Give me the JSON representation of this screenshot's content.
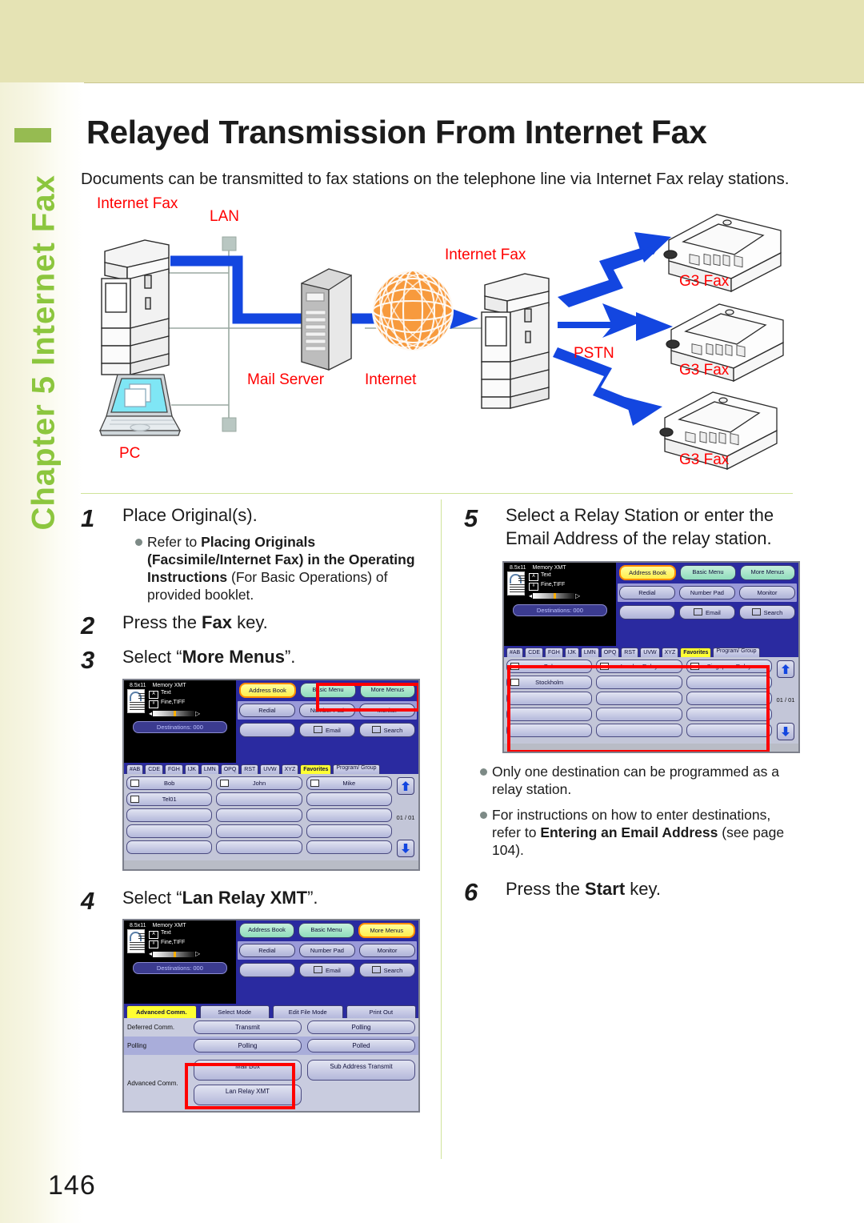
{
  "sidebar": {
    "chapter_label": "Chapter 5  Internet Fax"
  },
  "page": {
    "number": "146",
    "title": "Relayed Transmission From Internet Fax",
    "intro": "Documents can be transmitted to fax stations on the telephone line via Internet Fax relay stations."
  },
  "diagram": {
    "labels": {
      "internet_fax_left": "Internet Fax",
      "lan": "LAN",
      "mail_server": "Mail Server",
      "internet": "Internet",
      "pc": "PC",
      "internet_fax_right": "Internet Fax",
      "pstn": "PSTN",
      "g3fax_1": "G3 Fax",
      "g3fax_2": "G3 Fax",
      "g3fax_3": "G3 Fax"
    }
  },
  "steps": {
    "s1": {
      "num": "1",
      "text": "Place Original(s).",
      "bullet_pre": "Refer to ",
      "bullet_b1": "Placing Originals (Facsimile/Internet Fax) in the Operating Instructions",
      "bullet_post": " (For Basic Operations) of provided booklet."
    },
    "s2": {
      "num": "2",
      "pre": "Press the ",
      "bold": "Fax",
      "post": " key."
    },
    "s3": {
      "num": "3",
      "pre": "Select “",
      "bold": "More Menus",
      "post": "”."
    },
    "s4": {
      "num": "4",
      "pre": "Select “",
      "bold": "Lan Relay XMT",
      "post": "”."
    },
    "s5": {
      "num": "5",
      "text": "Select a Relay Station or enter the Email Address of the relay station.",
      "bullet1": "Only one destination can be programmed as a relay station.",
      "bullet2_pre": "For instructions on how to enter destinations, refer to ",
      "bullet2_b": "Entering an Email Address",
      "bullet2_post": " (see page 104)."
    },
    "s6": {
      "num": "6",
      "pre": "Press the ",
      "bold": "Start",
      "post": " key."
    }
  },
  "lcd_common": {
    "paper_size": "8.5x11",
    "mode": "Memory XMT",
    "quality_text": "Text",
    "quality_res": "Fine,TIFF",
    "destinations": "Destinations: 000",
    "top_buttons": [
      "Address Book",
      "Basic Menu",
      "More Menus"
    ],
    "mid_buttons": [
      "Redial",
      "Number Pad",
      "Monitor"
    ],
    "low_buttons": [
      "Email",
      "Search"
    ],
    "alpha_tabs": [
      "#AB",
      "CDE",
      "FGH",
      "IJK",
      "LMN",
      "OPQ",
      "RST",
      "UVW",
      "XYZ"
    ],
    "tab_favorites": "Favorites",
    "tab_program": "Program/ Group",
    "page_indicator": "01 / 01"
  },
  "lcd_step3": {
    "highlight": "More Menus",
    "entries": [
      [
        "Bob",
        "John",
        "Mike"
      ],
      [
        "Tel01",
        "",
        ""
      ],
      [
        "",
        "",
        ""
      ],
      [
        "",
        "",
        ""
      ],
      [
        "",
        "",
        ""
      ]
    ]
  },
  "lcd_step4": {
    "highlight": "Lan Relay XMT",
    "tabs": [
      "Advanced Comm.",
      "Select Mode",
      "Edit File Mode",
      "Print Out"
    ],
    "rows": [
      {
        "label": "Deferred Comm.",
        "buttons": [
          "Transmit",
          "Polling"
        ]
      },
      {
        "label": "Polling",
        "buttons": [
          "Polling",
          "Polled"
        ]
      },
      {
        "label": "Advanced Comm.",
        "buttons": [
          "Mail Box",
          "Sub Address Transmit",
          "Lan Relay XMT"
        ]
      }
    ]
  },
  "lcd_step5": {
    "highlight": "destination list",
    "entries": [
      [
        "Bob",
        "London Relay",
        "Singapore Relay"
      ],
      [
        "Stockholm",
        "",
        ""
      ],
      [
        "",
        "",
        ""
      ],
      [
        "",
        "",
        ""
      ],
      [
        "",
        "",
        ""
      ]
    ]
  },
  "colors": {
    "band": "#e5e3b4",
    "chapter_green": "#8cc63e",
    "tab_green": "#96bb51",
    "diagram_red": "#ff0000",
    "arrow_blue": "#1346e0",
    "highlight_red": "#ff0000",
    "globe_orange": "#f8993c"
  }
}
